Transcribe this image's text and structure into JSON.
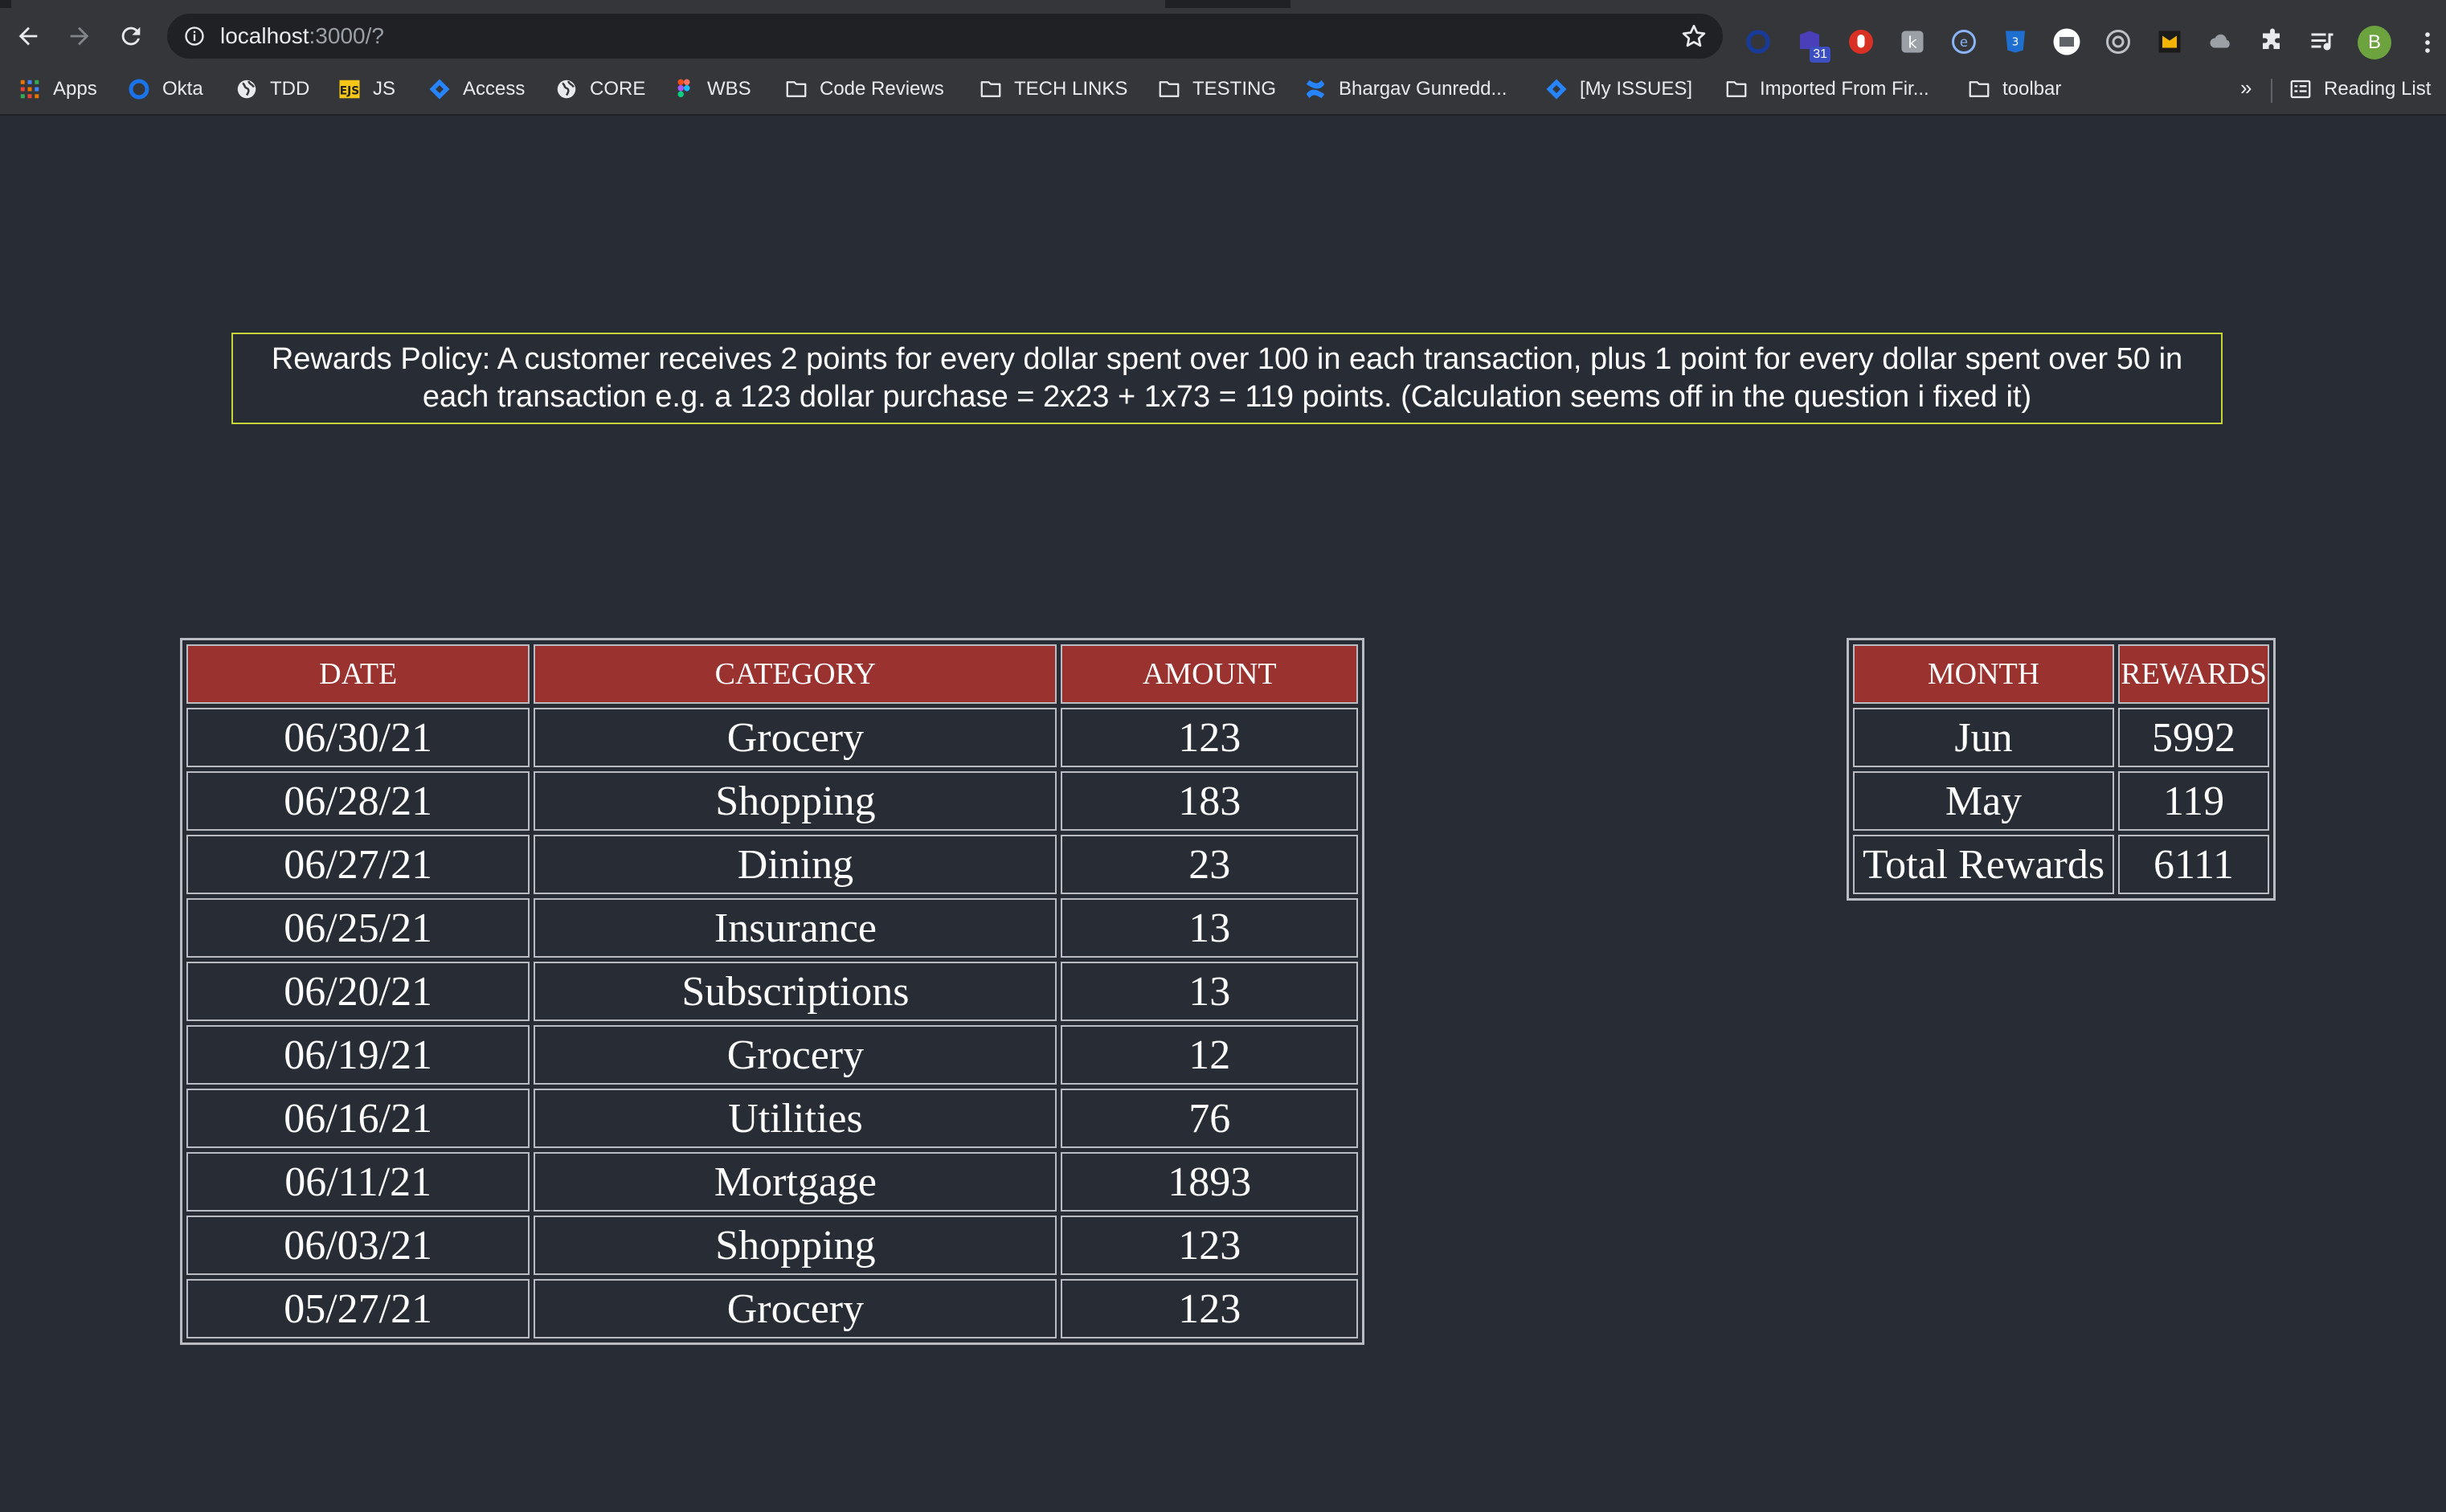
{
  "browser": {
    "url_host": "localhost",
    "url_rest": ":3000/?",
    "profile_initial": "B",
    "extension_badge": "31",
    "bookmarks": [
      {
        "label": "Apps",
        "icon": "apps-grid-icon"
      },
      {
        "label": "Okta",
        "icon": "okta-icon"
      },
      {
        "label": "TDD",
        "icon": "globe-icon"
      },
      {
        "label": "JS",
        "icon": "ejs-icon"
      },
      {
        "label": "Access",
        "icon": "jira-icon"
      },
      {
        "label": "CORE",
        "icon": "globe-icon"
      },
      {
        "label": "WBS",
        "icon": "figma-icon"
      },
      {
        "label": "Code Reviews",
        "icon": "folder-icon"
      },
      {
        "label": "TECH LINKS",
        "icon": "folder-icon"
      },
      {
        "label": "TESTING",
        "icon": "folder-icon"
      },
      {
        "label": "Bhargav Gunredd...",
        "icon": "confluence-icon"
      },
      {
        "label": "[My ISSUES]",
        "icon": "jira-icon"
      },
      {
        "label": "Imported From Fir...",
        "icon": "folder-icon"
      },
      {
        "label": "toolbar",
        "icon": "folder-icon"
      }
    ],
    "more_label": "»",
    "reading_list_label": "Reading List"
  },
  "policy": {
    "text": "Rewards Policy: A customer receives 2 points for every dollar spent over 100 in each transaction, plus 1 point for every dollar spent over 50 in each transaction e.g. a 123 dollar purchase = 2x23 + 1x73 = 119 points. (Calculation seems off in the question i fixed it)"
  },
  "transactions": {
    "headers": [
      "DATE",
      "CATEGORY",
      "AMOUNT"
    ],
    "rows": [
      [
        "06/30/21",
        "Grocery",
        "123"
      ],
      [
        "06/28/21",
        "Shopping",
        "183"
      ],
      [
        "06/27/21",
        "Dining",
        "23"
      ],
      [
        "06/25/21",
        "Insurance",
        "13"
      ],
      [
        "06/20/21",
        "Subscriptions",
        "13"
      ],
      [
        "06/19/21",
        "Grocery",
        "12"
      ],
      [
        "06/16/21",
        "Utilities",
        "76"
      ],
      [
        "06/11/21",
        "Mortgage",
        "1893"
      ],
      [
        "06/03/21",
        "Shopping",
        "123"
      ],
      [
        "05/27/21",
        "Grocery",
        "123"
      ]
    ]
  },
  "rewards": {
    "headers": [
      "MONTH",
      "REWARDS"
    ],
    "rows": [
      [
        "Jun",
        "5992"
      ],
      [
        "May",
        "119"
      ],
      [
        "Total Rewards",
        "6111"
      ]
    ]
  },
  "colors": {
    "page_background": "#282c34",
    "header_background": "#9a3230",
    "policy_border": "#c6d43a",
    "table_border": "#b9bcc2"
  }
}
